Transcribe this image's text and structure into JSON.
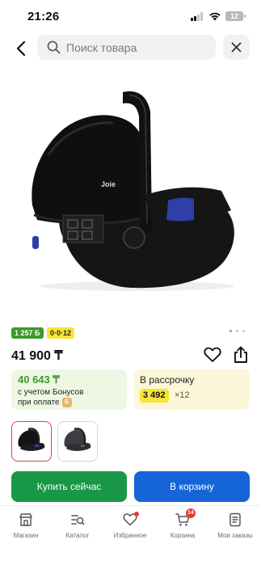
{
  "status_bar": {
    "time": "21:26",
    "battery_level": "12",
    "icons": [
      "signal-icon",
      "wifi-icon",
      "battery-icon"
    ]
  },
  "header": {
    "back_icon": "chevron-left-icon",
    "search": {
      "placeholder": "Поиск товара",
      "icon": "search-icon"
    },
    "close_icon": "close-icon"
  },
  "gallery": {
    "image": "car-seat-photo",
    "brand_mark": "Joie",
    "dots_count": 3,
    "active_dot": 1
  },
  "badges": {
    "bonus": "1 257 Б",
    "installment": "0·0·12",
    "bonus_color": "#3f9b2a",
    "installment_color": "#f7e533"
  },
  "price": {
    "value": "41 900 ₸",
    "favorite_icon": "heart-icon",
    "share_icon": "share-icon"
  },
  "bonus_card": {
    "price": "40 643 ₸",
    "line1": "с учетом Бонусов",
    "line2": "при оплате",
    "coin": "Б"
  },
  "installment_card": {
    "title": "В рассрочку",
    "amount": "3 492",
    "term": "×12"
  },
  "thumbnails": [
    {
      "name": "variant-black",
      "selected": true
    },
    {
      "name": "variant-grey",
      "selected": false
    }
  ],
  "actions": {
    "buy_now": "Купить сейчас",
    "add_to_cart": "В корзину",
    "buy_color": "#189846",
    "cart_color": "#1565d8"
  },
  "tab_bar": {
    "items": [
      {
        "label": "Магазин",
        "icon": "shop-icon"
      },
      {
        "label": "Каталог",
        "icon": "catalog-icon"
      },
      {
        "label": "Избранное",
        "icon": "heart-icon"
      },
      {
        "label": "Корзина",
        "icon": "cart-icon",
        "badge": "14"
      },
      {
        "label": "Мои заказы",
        "icon": "orders-icon"
      }
    ]
  }
}
